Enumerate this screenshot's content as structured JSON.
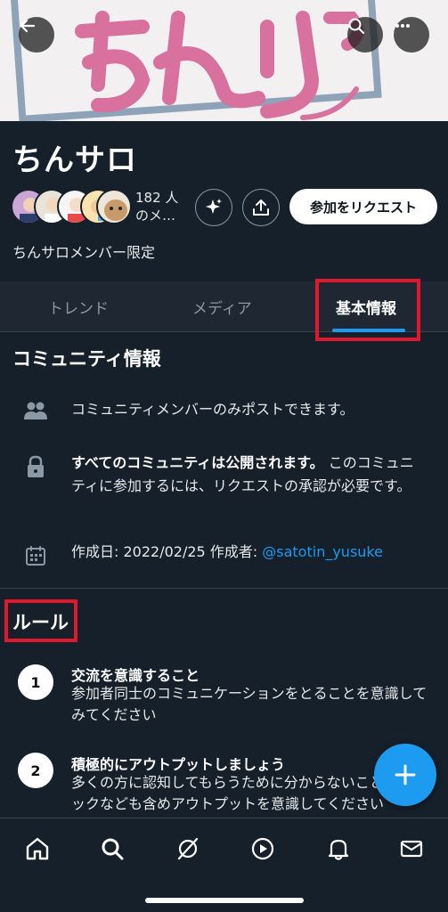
{
  "header": {
    "title": "ちんサロ",
    "member_count": "182 人",
    "member_suffix": "のメ…",
    "join_label": "参加をリクエスト",
    "description": "ちんサロメンバー限定"
  },
  "tabs": [
    {
      "label": "トレンド"
    },
    {
      "label": "メディア"
    },
    {
      "label": "基本情報",
      "active": true
    }
  ],
  "community_info": {
    "title": "コミュニティ情報",
    "members_only": "コミュニティメンバーのみポストできます。",
    "public_bold": "すべてのコミュニティは公開されます。",
    "public_rest": " このコミュニティに参加するには、リクエストの承認が必要です。",
    "created_prefix": "作成日: 2022/02/25 作成者: ",
    "creator_handle": "@satotin_yusuke"
  },
  "rules": {
    "title": "ルール",
    "items": [
      {
        "number": "1",
        "title": "交流を意識すること",
        "desc": "参加者同士のコミュニケーションをとることを意識してみてください"
      },
      {
        "number": "2",
        "title": "積極的にアウトプットしましょう",
        "desc": "多くの方に認知してもらうために分からないことやトピックなども含めアウトプットを意識してください"
      }
    ]
  },
  "colors": {
    "background": "#15202b",
    "accent": "#1d9bf0",
    "highlight": "#e0182d"
  },
  "icons": {
    "back": "arrow-left-icon",
    "search": "search-icon",
    "more": "more-icon",
    "sparkle": "sparkle-icon",
    "share": "share-icon",
    "members": "people-icon",
    "lock": "lock-icon",
    "calendar": "calendar-icon",
    "compose": "plus-icon",
    "nav": [
      "home-icon",
      "search-icon",
      "grok-icon",
      "video-icon",
      "bell-icon",
      "mail-icon"
    ]
  }
}
